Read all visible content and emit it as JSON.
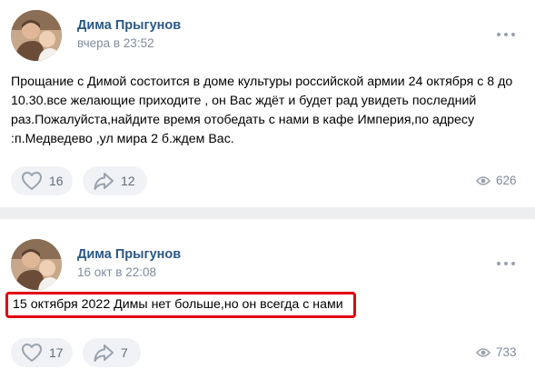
{
  "posts": [
    {
      "author": "Дима Прыгунов",
      "time": "вчера в 23:52",
      "text": "Прощание с Димой состоится в доме культуры российской армии 24 октября с 8 до 10.30.все желающие приходите , он Вас ждёт и будет рад увидеть последний раз.Пожалуйста,найдите время отобедать с нами в кафе Империя,по адресу :п.Медведево ,ул мира 2 б.ждем Вас.",
      "likes": "16",
      "shares": "12",
      "views": "626"
    },
    {
      "author": "Дима Прыгунов",
      "time": "16 окт в 22:08",
      "text": "15 октября 2022 Димы нет больше,но он всегда с нами",
      "likes": "17",
      "shares": "7",
      "views": "733",
      "highlighted": true
    }
  ],
  "colors": {
    "author": "#2a5885",
    "meta": "#818c99",
    "pill_bg": "#f0f2f5",
    "highlight_border": "#e3000f",
    "feed_gap": "#edeef0"
  },
  "icons": [
    "avatar",
    "more-icon",
    "heart-icon",
    "share-icon",
    "eye-icon"
  ]
}
